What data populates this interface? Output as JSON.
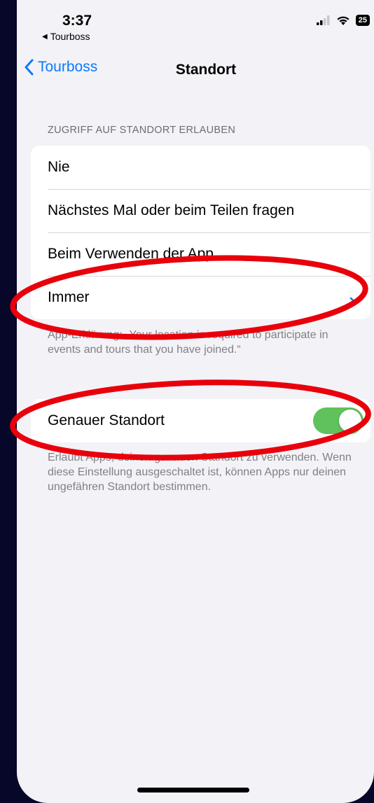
{
  "status_bar": {
    "time": "3:37",
    "back_app": "Tourboss",
    "battery": "25"
  },
  "nav": {
    "back_label": "Tourboss",
    "title": "Standort"
  },
  "location_access": {
    "header": "ZUGRIFF AUF STANDORT ERLAUBEN",
    "options": [
      {
        "label": "Nie"
      },
      {
        "label": "Nächstes Mal oder beim Teilen fragen"
      },
      {
        "label": "Beim Verwenden der App"
      },
      {
        "label": "Immer",
        "selected": true
      }
    ],
    "footer": "App-Erklärung: „Your location is required to participate in events and tours that you have joined.“"
  },
  "precise_location": {
    "label": "Genauer Standort",
    "enabled": true,
    "footer": "Erlaubt Apps, deinen genauen Standort zu verwenden. Wenn diese Einstellung ausgeschaltet ist, können Apps nur deinen ungefähren Standort bestimmen."
  },
  "colors": {
    "accent": "#0a7aff",
    "toggle_on": "#5fc25d",
    "annotation": "#e8000b"
  }
}
